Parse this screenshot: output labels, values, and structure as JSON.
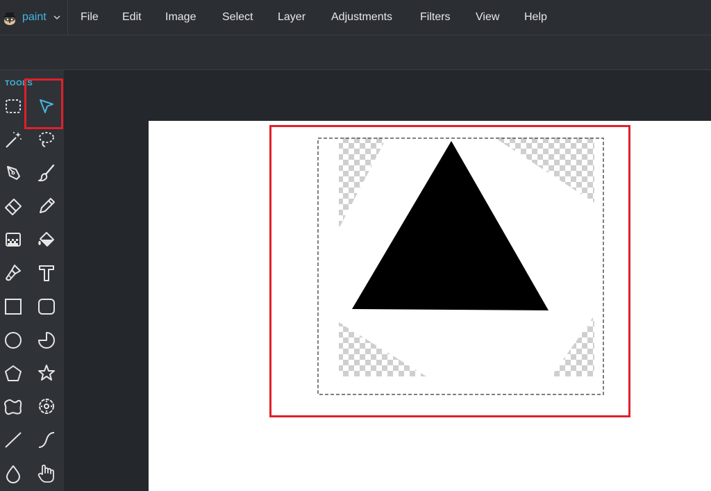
{
  "app": {
    "name": "paint",
    "logo_icon": "raccoon-logo-icon",
    "chevron_icon": "chevron-down-icon",
    "accent_color": "#45b6e0"
  },
  "menu": {
    "items": [
      "File",
      "Edit",
      "Image",
      "Select",
      "Layer",
      "Adjustments",
      "Filters",
      "View",
      "Help"
    ]
  },
  "tools": {
    "title": "TOOLS",
    "items": [
      {
        "name": "selection",
        "icon": "dashed-rect-select-icon",
        "selected": false
      },
      {
        "name": "move",
        "icon": "pointer-arrow-icon",
        "selected": true
      },
      {
        "name": "magic-wand",
        "icon": "magic-wand-icon",
        "selected": false
      },
      {
        "name": "lasso",
        "icon": "lasso-icon",
        "selected": false
      },
      {
        "name": "pen",
        "icon": "pen-nib-icon",
        "selected": false
      },
      {
        "name": "brush",
        "icon": "brush-icon",
        "selected": false
      },
      {
        "name": "eraser",
        "icon": "eraser-icon",
        "selected": false
      },
      {
        "name": "pencil",
        "icon": "pencil-icon",
        "selected": false
      },
      {
        "name": "gradient",
        "icon": "gradient-icon",
        "selected": false
      },
      {
        "name": "fill",
        "icon": "paint-bucket-icon",
        "selected": false
      },
      {
        "name": "clone",
        "icon": "stamp-icon",
        "selected": false
      },
      {
        "name": "text",
        "icon": "text-icon",
        "selected": false
      },
      {
        "name": "rectangle",
        "icon": "rectangle-icon",
        "selected": false
      },
      {
        "name": "rounded-rectangle",
        "icon": "rounded-rectangle-icon",
        "selected": false
      },
      {
        "name": "ellipse",
        "icon": "circle-icon",
        "selected": false
      },
      {
        "name": "pie",
        "icon": "pie-icon",
        "selected": false
      },
      {
        "name": "polygon",
        "icon": "pentagon-icon",
        "selected": false
      },
      {
        "name": "star",
        "icon": "star-icon",
        "selected": false
      },
      {
        "name": "blob",
        "icon": "blob-icon",
        "selected": false
      },
      {
        "name": "flower",
        "icon": "flower-icon",
        "selected": false
      },
      {
        "name": "line",
        "icon": "line-icon",
        "selected": false
      },
      {
        "name": "curve",
        "icon": "curve-icon",
        "selected": false
      },
      {
        "name": "blur",
        "icon": "droplet-icon",
        "selected": false
      },
      {
        "name": "hand",
        "icon": "hand-icon",
        "selected": false
      }
    ]
  },
  "canvas": {
    "background_color": "#ffffff",
    "shape_color": "#000000",
    "highlight_color": "#e0202a"
  }
}
